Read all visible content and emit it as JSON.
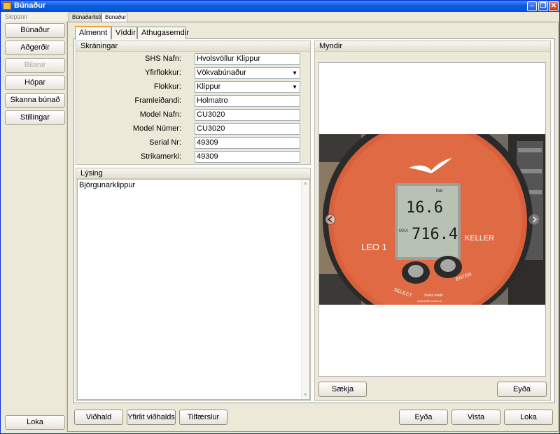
{
  "window": {
    "title": "Búnaður"
  },
  "nav": {
    "header": "Skipanir",
    "items": [
      {
        "label": "Búnaður",
        "enabled": true
      },
      {
        "label": "Aðgerðir",
        "enabled": true
      },
      {
        "label": "Bilanir",
        "enabled": false
      },
      {
        "label": "Hópar",
        "enabled": true
      },
      {
        "label": "Skanna búnað",
        "enabled": true
      },
      {
        "label": "Stillingar",
        "enabled": true
      }
    ],
    "close_label": "Loka"
  },
  "doc_tabs": [
    "Búnaðarlisti",
    "Búnaður"
  ],
  "inner_tabs": [
    "Almennt",
    "Víddir",
    "Athugasemdir"
  ],
  "registration": {
    "header": "Skráningar",
    "fields": [
      {
        "label": "SHS Nafn:",
        "value": "Hvolsvöllur Klippur"
      },
      {
        "label": "Yfirflokkur:",
        "value": "Vökvabúnaður"
      },
      {
        "label": "Flokkur:",
        "value": "Klippur"
      },
      {
        "label": "Framleiðandi:",
        "value": "Holmatro"
      },
      {
        "label": "Model Nafn:",
        "value": "CU3020"
      },
      {
        "label": "Model Númer:",
        "value": "CU3020"
      },
      {
        "label": "Serial Nr:",
        "value": "49309"
      },
      {
        "label": "Strikamerki:",
        "value": "49309"
      }
    ]
  },
  "description": {
    "header": "Lýsing",
    "text": "Björgunarklippur"
  },
  "images": {
    "header": "Myndir",
    "photo_text": {
      "unit": "bar",
      "reading_top": "16.6",
      "reading_bottom": "716.4",
      "max_label": "MAX",
      "model": "LEO 1",
      "brand": "KELLER",
      "select": "SELECT",
      "enter": "ENTER",
      "swiss": "Swiss made",
      "url": "www.keller-druck.ch"
    },
    "fetch_label": "Sækja",
    "delete_label": "Eyða"
  },
  "footer": {
    "maintenance_label": "Viðhald",
    "maintenance_overview_label": "Yfirlit viðhalds",
    "transfers_label": "Tilfærslur",
    "delete_label": "Eyða",
    "save_label": "Vista",
    "close_label": "Loka"
  }
}
